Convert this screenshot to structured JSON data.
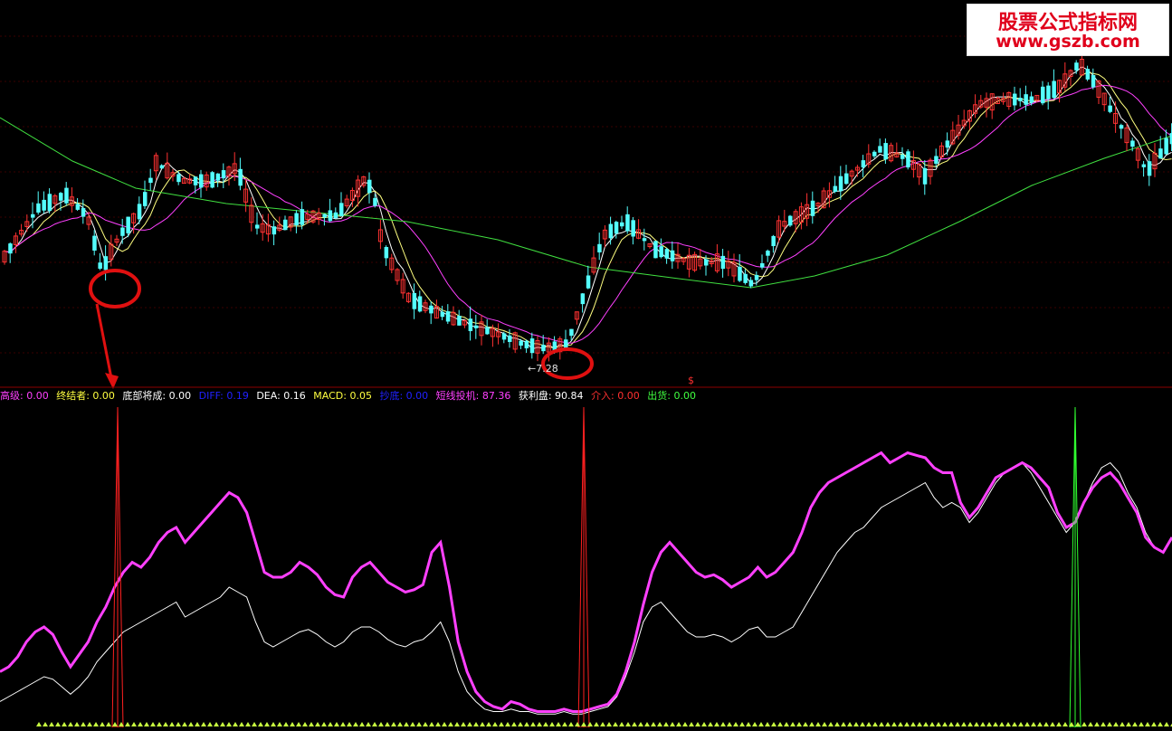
{
  "watermark": {
    "line1": "股票公式指标网",
    "line2": "www.gszb.com"
  },
  "price_panel": {
    "low_label": "←7.28",
    "marker": "$",
    "colors": {
      "up": "#ff3232",
      "down": "#54ffff",
      "ma_fast": "#ffffff",
      "ma_mid": "#ffff80",
      "ma_slow": "#ff40ff",
      "ma_long": "#40e040",
      "annotation": "#e01010"
    }
  },
  "indicator_legend": [
    {
      "key": "高级",
      "label": "高级: 0.00",
      "color": "#ff40ff"
    },
    {
      "key": "终结者",
      "label": "终结者: 0.00",
      "color": "#ffff40"
    },
    {
      "key": "底部将成",
      "label": "底部将成: 0.00",
      "color": "#ffffff"
    },
    {
      "key": "DIFF",
      "label": "DIFF: 0.19",
      "color": "#2020ff"
    },
    {
      "key": "DEA",
      "label": "DEA: 0.16",
      "color": "#ffffff"
    },
    {
      "key": "MACD",
      "label": "MACD: 0.05",
      "color": "#ffff40"
    },
    {
      "key": "抄底",
      "label": "抄底: 0.00",
      "color": "#2020ff"
    },
    {
      "key": "短线投机",
      "label": "短线投机: 87.36",
      "color": "#ff40ff"
    },
    {
      "key": "获利盘",
      "label": "获利盘: 90.84",
      "color": "#ffffff"
    },
    {
      "key": "介入",
      "label": "介入: 0.00",
      "color": "#ff3030"
    },
    {
      "key": "出货",
      "label": "出货: 0.00",
      "color": "#40ff40"
    }
  ],
  "chart_data": [
    {
      "type": "candlestick",
      "series": [
        {
          "name": "K",
          "description": "daily candles, approximate"
        }
      ],
      "low_marked": 7.28
    },
    {
      "type": "line",
      "series": [
        {
          "name": "短线投机",
          "color": "#ff40ff",
          "values": [
            18,
            20,
            24,
            30,
            34,
            36,
            33,
            26,
            20,
            25,
            30,
            38,
            44,
            52,
            58,
            62,
            60,
            64,
            70,
            74,
            76,
            70,
            74,
            78,
            82,
            86,
            90,
            88,
            82,
            70,
            58,
            56,
            56,
            58,
            62,
            60,
            57,
            52,
            49,
            48,
            56,
            60,
            62,
            58,
            54,
            52,
            50,
            51,
            53,
            66,
            70,
            52,
            30,
            18,
            10,
            6,
            4,
            3,
            6,
            5,
            3,
            2,
            2,
            2,
            3,
            2,
            2,
            3,
            4,
            5,
            9,
            18,
            30,
            45,
            58,
            66,
            70,
            66,
            62,
            58,
            56,
            57,
            55,
            52,
            54,
            56,
            60,
            56,
            58,
            62,
            66,
            74,
            84,
            90,
            94,
            96,
            98,
            100,
            102,
            104,
            106,
            102,
            104,
            106,
            105,
            104,
            100,
            98,
            98,
            86,
            80,
            84,
            90,
            96,
            98,
            100,
            102,
            100,
            96,
            92,
            82,
            76,
            78,
            86,
            92,
            96,
            98,
            94,
            88,
            82,
            72,
            68,
            66,
            72
          ],
          "range": [
            0,
            120
          ]
        },
        {
          "name": "获利盘",
          "color": "#ffffff",
          "values": [
            6,
            8,
            10,
            12,
            14,
            16,
            15,
            12,
            9,
            12,
            16,
            22,
            26,
            30,
            34,
            36,
            38,
            40,
            42,
            44,
            46,
            40,
            42,
            44,
            46,
            48,
            52,
            50,
            48,
            38,
            30,
            28,
            30,
            32,
            34,
            35,
            33,
            30,
            28,
            30,
            34,
            36,
            36,
            34,
            31,
            29,
            28,
            30,
            31,
            34,
            38,
            30,
            18,
            10,
            6,
            3,
            2,
            2,
            3,
            2,
            2,
            1,
            1,
            1,
            2,
            1,
            1,
            2,
            3,
            4,
            8,
            16,
            26,
            38,
            44,
            46,
            42,
            38,
            34,
            32,
            32,
            33,
            32,
            30,
            32,
            35,
            36,
            32,
            32,
            34,
            36,
            42,
            48,
            54,
            60,
            66,
            70,
            74,
            76,
            80,
            84,
            86,
            88,
            90,
            92,
            94,
            88,
            84,
            86,
            84,
            78,
            82,
            88,
            94,
            98,
            100,
            102,
            98,
            92,
            86,
            80,
            74,
            78,
            86,
            94,
            100,
            102,
            98,
            90,
            84,
            74,
            68,
            66,
            72
          ],
          "range": [
            0,
            120
          ]
        }
      ],
      "signal_bars": [
        {
          "series": "介入",
          "color": "#ff2020",
          "positions": [
            130,
            645
          ]
        },
        {
          "series": "出货",
          "color": "#30ff30",
          "positions": [
            1188
          ]
        }
      ]
    }
  ]
}
